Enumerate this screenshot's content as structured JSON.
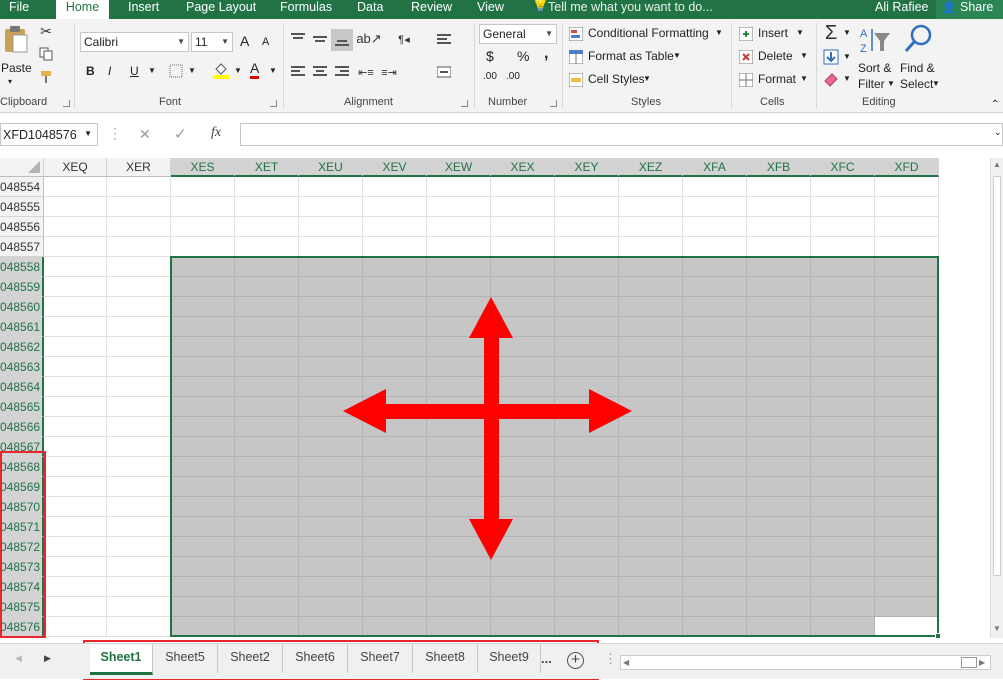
{
  "menu": {
    "tabs": [
      "File",
      "Home",
      "Insert",
      "Page Layout",
      "Formulas",
      "Data",
      "Review",
      "View"
    ],
    "active_tab": "Home",
    "tell_me": "Tell me what you want to do...",
    "user": "Ali Rafiee",
    "share": "Share"
  },
  "ribbon": {
    "clipboard": {
      "paste": "Paste",
      "label": "Clipboard"
    },
    "font": {
      "name": "Calibri",
      "size": "11",
      "bold": "B",
      "italic": "I",
      "underline": "U",
      "grow": "A",
      "shrink": "A",
      "font_color_letter": "A",
      "label": "Font"
    },
    "alignment": {
      "label": "Alignment"
    },
    "number": {
      "format": "General",
      "currency": "$",
      "percent": "%",
      "comma": ",",
      "inc_decimal": ".00",
      "dec_decimal": ".00",
      "label": "Number"
    },
    "styles": {
      "conditional_formatting": "Conditional Formatting",
      "format_as_table": "Format as Table",
      "cell_styles": "Cell Styles",
      "label": "Styles"
    },
    "cells": {
      "insert": "Insert",
      "delete": "Delete",
      "format": "Format",
      "label": "Cells"
    },
    "editing": {
      "sort_filter_1": "Sort &",
      "sort_filter_2": "Filter",
      "find_select_1": "Find &",
      "find_select_2": "Select",
      "label": "Editing"
    }
  },
  "formula_bar": {
    "name_box": "XFD1048576",
    "fx": "fx",
    "cancel": "✕",
    "enter": "✓",
    "value": ""
  },
  "grid": {
    "columns": [
      "XEQ",
      "XER",
      "XES",
      "XET",
      "XEU",
      "XEV",
      "XEW",
      "XEX",
      "XEY",
      "XEZ",
      "XFA",
      "XFB",
      "XFC",
      "XFD"
    ],
    "selected_columns": [
      "XES",
      "XET",
      "XEU",
      "XEV",
      "XEW",
      "XEX",
      "XEY",
      "XEZ",
      "XFA",
      "XFB",
      "XFC",
      "XFD"
    ],
    "rows": [
      "048554",
      "048555",
      "048556",
      "048557",
      "048558",
      "048559",
      "048560",
      "048561",
      "048562",
      "048563",
      "048564",
      "048565",
      "048566",
      "048567",
      "048568",
      "048569",
      "048570",
      "048571",
      "048572",
      "048573",
      "048574",
      "048575",
      "048576"
    ],
    "selected_rows_from": "048558",
    "active_cell": "XFD1048576"
  },
  "sheets": {
    "tabs": [
      "Sheet1",
      "Sheet5",
      "Sheet2",
      "Sheet6",
      "Sheet7",
      "Sheet8",
      "Sheet9"
    ],
    "active": "Sheet1",
    "more": "...",
    "add": "+"
  },
  "colors": {
    "excel_green": "#217346",
    "selection_fill": "#c6c6c6",
    "annotation_red": "#ff0000",
    "annotation_box": "#e8262b"
  }
}
